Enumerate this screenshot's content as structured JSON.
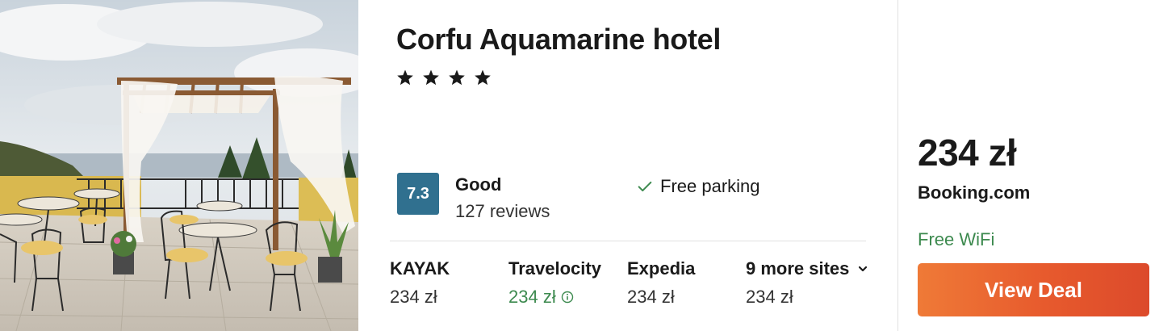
{
  "hotel": {
    "name": "Corfu Aquamarine hotel",
    "star_rating": 4,
    "rating": {
      "score": "7.3",
      "label": "Good",
      "reviews": "127 reviews",
      "badge_color": "#30708f"
    },
    "amenity": {
      "icon": "check-icon",
      "label": "Free parking",
      "icon_color": "#3d8a4f"
    }
  },
  "sites": [
    {
      "name": "KAYAK",
      "price": "234 zł",
      "highlight": false
    },
    {
      "name": "Travelocity",
      "price": "234 zł",
      "highlight": true,
      "price_icon": "info-icon"
    },
    {
      "name": "Expedia",
      "price": "234 zł",
      "highlight": false
    },
    {
      "name": "9 more sites",
      "price": "234 zł",
      "highlight": false,
      "name_icon": "chevron-down-icon"
    }
  ],
  "deal": {
    "price": "234 zł",
    "provider": "Booking.com",
    "perk": "Free WiFi",
    "button_label": "View Deal",
    "button_color": "#e75a2d",
    "perk_color": "#3d8a4f"
  }
}
